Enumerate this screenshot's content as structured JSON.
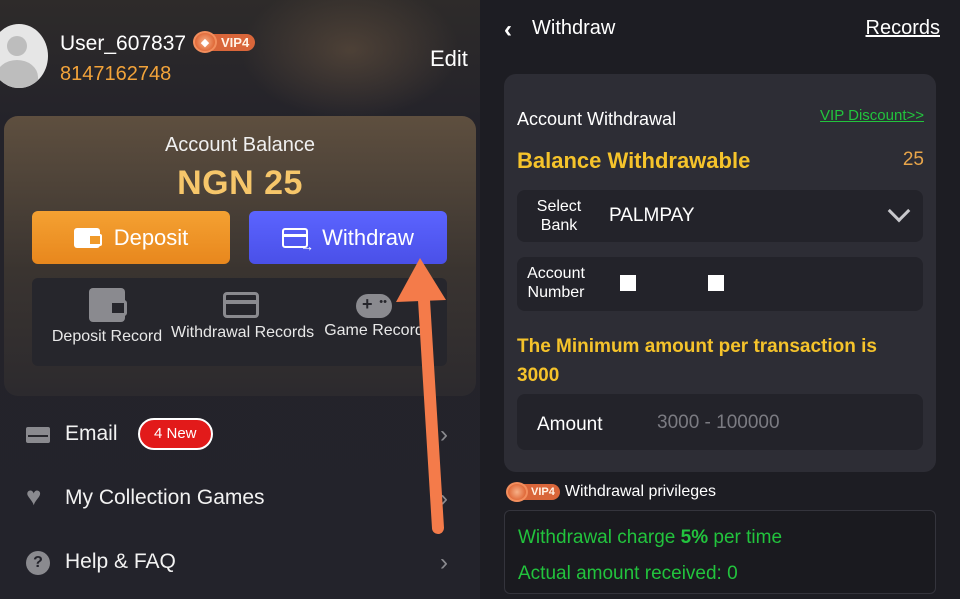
{
  "left": {
    "user": {
      "name": "User_607837",
      "vip": "VIP4",
      "vip_icon": "vip-diamond-icon",
      "phone": "8147162748",
      "edit_label": "Edit"
    },
    "balance": {
      "label": "Account Balance",
      "value": "NGN 25"
    },
    "buttons": {
      "deposit": "Deposit",
      "withdraw": "Withdraw"
    },
    "records": [
      {
        "label": "Deposit Record",
        "icon": "wallet-icon"
      },
      {
        "label": "Withdrawal Records",
        "icon": "card-transfer-icon"
      },
      {
        "label": "Game Record",
        "icon": "gamepad-icon"
      }
    ],
    "menu": [
      {
        "label": "Email",
        "icon": "envelope-icon",
        "badge": "4 New"
      },
      {
        "label": "My Collection Games",
        "icon": "heart-icon"
      },
      {
        "label": "Help & FAQ",
        "icon": "help-icon"
      }
    ]
  },
  "right": {
    "header": {
      "title": "Withdraw",
      "records_link": "Records"
    },
    "account_withdrawal": "Account Withdrawal",
    "vip_discount": "VIP Discount>>",
    "balance_withdrawable": {
      "label": "Balance Withdrawable",
      "value": "25"
    },
    "select_bank": {
      "label": "Select Bank",
      "value": "PALMPAY"
    },
    "account_number": {
      "label": "Account Number"
    },
    "min_message": "The Minimum amount per transaction is 3000",
    "amount": {
      "label": "Amount",
      "placeholder": "3000 - 100000"
    },
    "privileges": {
      "vip": "VIP4",
      "label": "Withdrawal privileges",
      "charge_prefix": "Withdrawal charge ",
      "charge_value": "5%",
      "charge_suffix": " per time",
      "received_prefix": "Actual amount received: ",
      "received_value": "0"
    }
  },
  "colors": {
    "accent_gold": "#f5c32b",
    "deposit_orange": "#e8871d",
    "withdraw_blue": "#5b64ff",
    "positive_green": "#22c33d",
    "badge_red": "#e21a1a",
    "annotation_arrow": "#f47b4a"
  }
}
